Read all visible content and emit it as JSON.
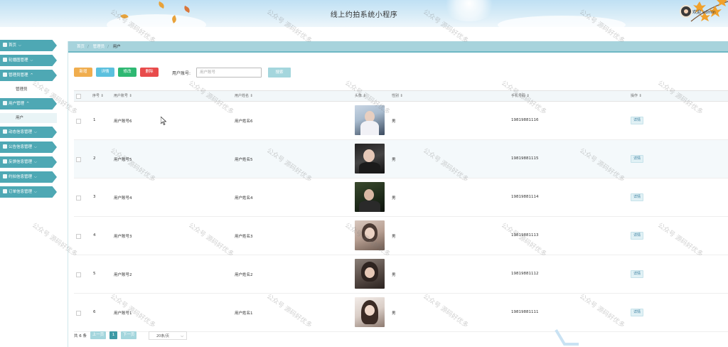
{
  "header": {
    "title": "线上约拍系统小程序",
    "user_name": "欢迎 admin"
  },
  "sidebar": {
    "items": [
      {
        "label": "首页",
        "icon": "home-icon"
      },
      {
        "label": "轮播图管理",
        "icon": "grid-icon"
      },
      {
        "label": "管理员管理",
        "icon": "grid-icon",
        "expanded": true,
        "children": [
          {
            "label": "管理员"
          }
        ]
      },
      {
        "label": "用户管理",
        "icon": "user-icon",
        "expanded": true,
        "children": [
          {
            "label": "用户"
          }
        ]
      },
      {
        "label": "动态信息管理",
        "icon": "file-icon"
      },
      {
        "label": "公告信息管理",
        "icon": "grid-icon"
      },
      {
        "label": "反馈信息管理",
        "icon": "grid-icon"
      },
      {
        "label": "约拍信息管理",
        "icon": "camera-icon"
      },
      {
        "label": "订单信息管理",
        "icon": "folder-icon"
      }
    ]
  },
  "breadcrumb": {
    "home": "首页",
    "level1": "管理员",
    "current": "用户"
  },
  "toolbar": {
    "add": "新增",
    "detail": "详情",
    "edit": "修改",
    "delete": "删除"
  },
  "search": {
    "label": "用户账号:",
    "placeholder": "用户账号",
    "button": "搜索"
  },
  "table": {
    "headers": [
      "序号",
      "用户账号",
      "用户姓名",
      "头像",
      "性别",
      "手机号码",
      "操作"
    ],
    "rows": [
      {
        "index": "1",
        "account": "用户账号6",
        "name": "用户姓名6",
        "gender": "男",
        "phone": "19819881116",
        "action": "详情"
      },
      {
        "index": "2",
        "account": "用户账号5",
        "name": "用户姓名5",
        "gender": "男",
        "phone": "19819881115",
        "action": "详情"
      },
      {
        "index": "3",
        "account": "用户账号4",
        "name": "用户姓名4",
        "gender": "男",
        "phone": "19819881114",
        "action": "详情"
      },
      {
        "index": "4",
        "account": "用户账号3",
        "name": "用户姓名3",
        "gender": "男",
        "phone": "19819881113",
        "action": "详情"
      },
      {
        "index": "5",
        "account": "用户账号2",
        "name": "用户姓名2",
        "gender": "男",
        "phone": "19819881112",
        "action": "详情"
      },
      {
        "index": "6",
        "account": "用户账号1",
        "name": "用户姓名1",
        "gender": "男",
        "phone": "19819881111",
        "action": "详情"
      }
    ]
  },
  "pagination": {
    "total": "共 6 条",
    "prev": "上一页",
    "page": "1",
    "next": "下一页",
    "page_size": "20条/页"
  },
  "watermark_text": "公众号 源码好优多",
  "colors": {
    "accent": "#4ea8b4",
    "add": "#f0ad4e",
    "detail": "#5bc0de",
    "edit": "#2eb872",
    "delete": "#e84b4b"
  }
}
